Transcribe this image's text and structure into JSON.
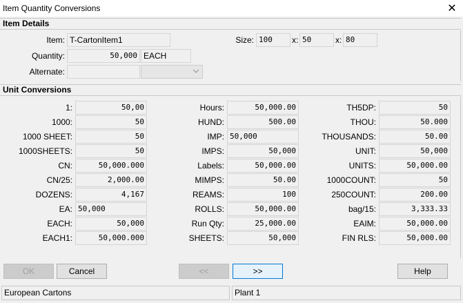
{
  "window": {
    "title": "Item Quantity Conversions",
    "close_glyph": "✕"
  },
  "item_details": {
    "header": "Item Details",
    "item_label": "Item:",
    "item_value": "T-CartonItem1",
    "size_label": "Size:",
    "size_x1": "100",
    "x_label1": "x:",
    "size_x2": "50",
    "x_label2": "x:",
    "size_x3": "80",
    "quantity_label": "Quantity:",
    "quantity_value": "50,000",
    "quantity_unit": "EACH",
    "alternate_label": "Alternate:",
    "alternate_value": "",
    "alternate_unit": ""
  },
  "unit_conversions": {
    "header": "Unit Conversions",
    "col1": [
      {
        "label": "1:",
        "value": "50,00"
      },
      {
        "label": "1000:",
        "value": "50"
      },
      {
        "label": "1000 SHEET:",
        "value": "50"
      },
      {
        "label": "1000SHEETS:",
        "value": "50"
      },
      {
        "label": "CN:",
        "value": "50,000.000"
      },
      {
        "label": "CN/25:",
        "value": "2,000.00"
      },
      {
        "label": "DOZENS:",
        "value": "4,167"
      },
      {
        "label": "EA:",
        "value": "50,000",
        "left": true
      },
      {
        "label": "EACH:",
        "value": "50,000"
      },
      {
        "label": "EACH1:",
        "value": "50,000.000"
      }
    ],
    "col2": [
      {
        "label": "Hours:",
        "value": "50,000.00"
      },
      {
        "label": "HUND:",
        "value": "500.00"
      },
      {
        "label": "IMP:",
        "value": "50,000",
        "left": true
      },
      {
        "label": "IMPS:",
        "value": "50,000"
      },
      {
        "label": "Labels:",
        "value": "50,000.00"
      },
      {
        "label": "MIMPS:",
        "value": "50.00"
      },
      {
        "label": "REAMS:",
        "value": "100"
      },
      {
        "label": "ROLLS:",
        "value": "50,000.00"
      },
      {
        "label": "Run Qty:",
        "value": "25,000.00"
      },
      {
        "label": "SHEETS:",
        "value": "50,000"
      }
    ],
    "col3": [
      {
        "label": "TH5DP:",
        "value": "50"
      },
      {
        "label": "THOU:",
        "value": "50.000"
      },
      {
        "label": "THOUSANDS:",
        "value": "50.00"
      },
      {
        "label": "UNIT:",
        "value": "50,000"
      },
      {
        "label": "UNITS:",
        "value": "50,000.00"
      },
      {
        "label": "1000COUNT:",
        "value": "50"
      },
      {
        "label": "250COUNT:",
        "value": "200.00"
      },
      {
        "label": "bag/15:",
        "value": "3,333.33"
      },
      {
        "label": "EAIM:",
        "value": "50,000.00"
      },
      {
        "label": "FIN RLS:",
        "value": "50,000.00"
      }
    ]
  },
  "buttons": {
    "ok": "OK",
    "cancel": "Cancel",
    "prev": "<<",
    "next": ">>",
    "help": "Help"
  },
  "status": {
    "company": "European Cartons",
    "plant": "Plant 1"
  }
}
